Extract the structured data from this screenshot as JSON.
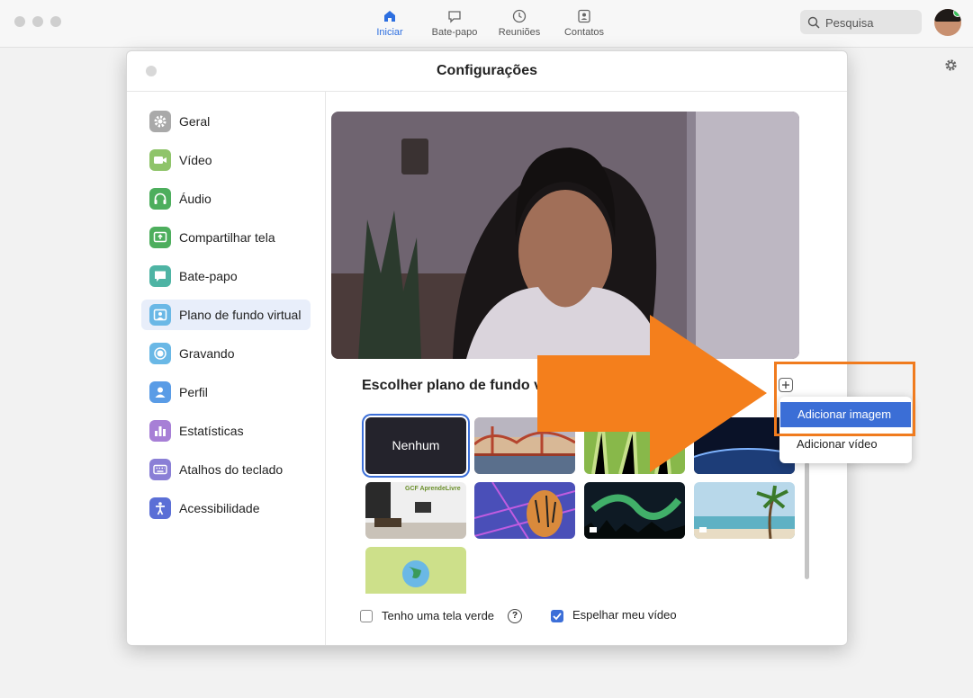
{
  "topbar": {
    "nav": [
      {
        "label": "Iniciar",
        "icon": "home-icon",
        "active": true
      },
      {
        "label": "Bate-papo",
        "icon": "chat-icon",
        "active": false
      },
      {
        "label": "Reuniões",
        "icon": "clock-icon",
        "active": false
      },
      {
        "label": "Contatos",
        "icon": "contacts-icon",
        "active": false
      }
    ],
    "search_placeholder": "Pesquisa"
  },
  "window": {
    "title": "Configurações"
  },
  "sidebar": {
    "items": [
      {
        "label": "Geral",
        "icon": "gear-icon",
        "color": "#a9a9a9"
      },
      {
        "label": "Vídeo",
        "icon": "video-camera-icon",
        "color": "#8fc46a"
      },
      {
        "label": "Áudio",
        "icon": "headphones-icon",
        "color": "#4dae5d"
      },
      {
        "label": "Compartilhar tela",
        "icon": "share-screen-icon",
        "color": "#4dae5d"
      },
      {
        "label": "Bate-papo",
        "icon": "chat-bubble-icon",
        "color": "#4eb4a4"
      },
      {
        "label": "Plano de fundo virtual",
        "icon": "virtual-background-icon",
        "color": "#6ab8e6",
        "active": true
      },
      {
        "label": "Gravando",
        "icon": "record-icon",
        "color": "#6ab8e6"
      },
      {
        "label": "Perfil",
        "icon": "profile-icon",
        "color": "#5a9ce6"
      },
      {
        "label": "Estatísticas",
        "icon": "statistics-icon",
        "color": "#a77fd6"
      },
      {
        "label": "Atalhos do teclado",
        "icon": "keyboard-icon",
        "color": "#8a7fd6"
      },
      {
        "label": "Acessibilidade",
        "icon": "accessibility-icon",
        "color": "#5b6fd6"
      }
    ]
  },
  "content": {
    "section_title": "Escolher plano de fundo v",
    "none_label": "Nenhum",
    "thumbnails": [
      {
        "name": "none"
      },
      {
        "name": "golden-gate-bridge"
      },
      {
        "name": "grass"
      },
      {
        "name": "earth-from-space"
      },
      {
        "name": "gcf-aprendelivre-office",
        "caption": "GCF AprendeLivre"
      },
      {
        "name": "tiger-neon"
      },
      {
        "name": "aurora",
        "video": true
      },
      {
        "name": "beach-palm",
        "video": true
      },
      {
        "name": "globe-green"
      }
    ],
    "green_screen_label": "Tenho uma tela verde",
    "green_screen_checked": false,
    "help_glyph": "?",
    "mirror_label": "Espelhar meu vídeo",
    "mirror_checked": true
  },
  "add_menu": {
    "items": [
      "Adicionar imagem",
      "Adicionar vídeo"
    ],
    "highlight_color": "#f07b1e"
  }
}
